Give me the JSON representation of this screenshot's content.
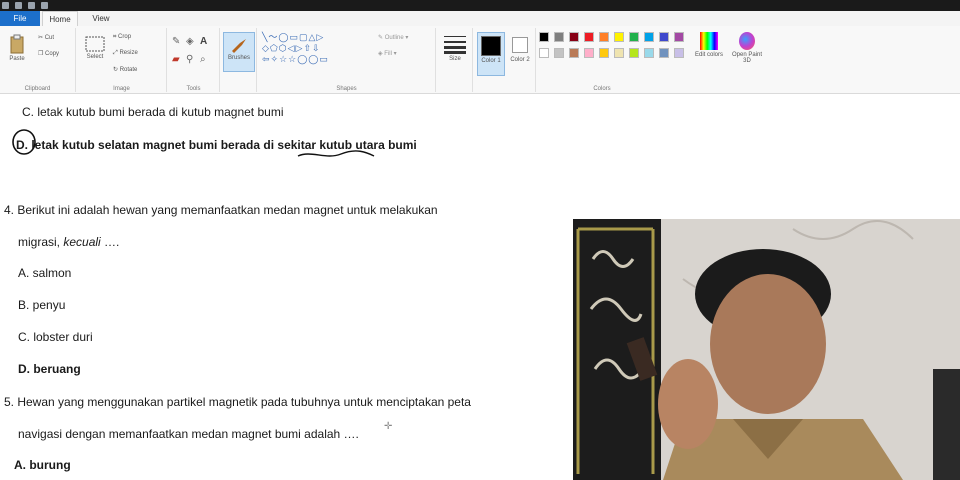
{
  "app": {
    "tabs": [
      "File",
      "Home",
      "View"
    ]
  },
  "ribbon": {
    "clipboard": {
      "paste": "Paste",
      "cut": "Cut",
      "copy": "Copy",
      "label": "Clipboard"
    },
    "image": {
      "select": "Select",
      "crop": "Crop",
      "resize": "Resize",
      "rotate": "Rotate",
      "label": "Image"
    },
    "tools": {
      "label": "Tools"
    },
    "brushes": {
      "label": "Brushes"
    },
    "shapes": {
      "outline": "Outline",
      "fill": "Fill",
      "label": "Shapes"
    },
    "size": {
      "label": "Size"
    },
    "color1": {
      "label": "Color 1"
    },
    "color2": {
      "label": "Color 2"
    },
    "colors": {
      "label": "Colors",
      "edit": "Edit colors",
      "paint3d": "Open Paint 3D",
      "row1": [
        "#000000",
        "#7f7f7f",
        "#880015",
        "#ed1c24",
        "#ff7f27",
        "#fff200",
        "#22b14c",
        "#00a2e8",
        "#3f48cc",
        "#a349a4"
      ],
      "row2": [
        "#ffffff",
        "#c3c3c3",
        "#b97a57",
        "#ffaec9",
        "#ffc90e",
        "#efe4b0",
        "#b5e61d",
        "#99d9ea",
        "#7092be",
        "#c8bfe7"
      ]
    }
  },
  "document": {
    "q3_option_c": "C.  letak kutub bumi berada di kutub magnet bumi",
    "q3_option_d": "D. letak kutub selatan magnet bumi berada di sekitar kutub utara bumi",
    "q4_line1": "4. Berikut ini adalah hewan yang memanfaatkan medan magnet untuk melakukan",
    "q4_line2_a": "migrasi, ",
    "q4_line2_b": "kecuali",
    "q4_line2_c": " ….",
    "q4_a": "A. salmon",
    "q4_b": "B. penyu",
    "q4_c": "C. lobster duri",
    "q4_d": "D. beruang",
    "q5_line1": "5. Hewan yang menggunakan partikel magnetik pada tubuhnya untuk menciptakan peta",
    "q5_line2": "navigasi dengan memanfaatkan medan magnet bumi adalah ….",
    "q5_a": "A. burung"
  }
}
